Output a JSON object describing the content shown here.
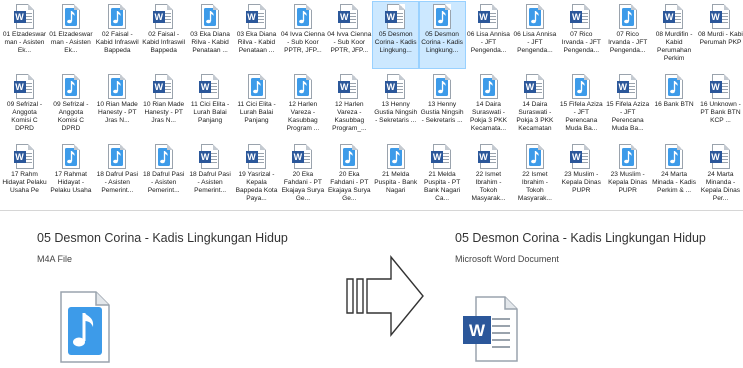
{
  "files": [
    {
      "type": "word",
      "label": "01 Elzadeswar man - Asisten Ek..."
    },
    {
      "type": "music",
      "label": "01 Elzadeswar man - Asisten Ek..."
    },
    {
      "type": "music",
      "label": "02 Faisal - Kabid Infraswil Bappeda"
    },
    {
      "type": "word",
      "label": "02 Faisal - Kabid Infraswil Bappeda"
    },
    {
      "type": "music",
      "label": "03 Eka Diana Rilva - Kabid Penataan ..."
    },
    {
      "type": "word",
      "label": "03 Eka Diana Rilva - Kabid Penataan ..."
    },
    {
      "type": "music",
      "label": "04 Ivva Cienna - Sub Koor PPTR, JFP..."
    },
    {
      "type": "word",
      "label": "04 Ivva Cienna - Sub Koor PPTR, JFP..."
    },
    {
      "type": "word",
      "label": "05 Desmon Corina - Kadis Lingkung...",
      "selected": true
    },
    {
      "type": "music",
      "label": "05 Desmon Corina - Kadis Lingkung...",
      "selected": true
    },
    {
      "type": "word",
      "label": "06 Lisa Annisa - JFT Pengenda..."
    },
    {
      "type": "music",
      "label": "06 Lisa Annisa - JFT Pengenda..."
    },
    {
      "type": "word",
      "label": "07 Rico Irvanda - JFT Pengenda..."
    },
    {
      "type": "music",
      "label": "07 Rico Irvanda - JFT Pengenda..."
    },
    {
      "type": "word",
      "label": "08 Murdifin - Kabid Perumahan Perkim"
    },
    {
      "type": "word",
      "label": "08 Murdi - Kabi Perumah PKP"
    },
    {
      "type": "word",
      "label": "09 Sefrizal - Anggota Komisi C DPRD"
    },
    {
      "type": "music",
      "label": "09 Sefrizal - Anggota Komisi C DPRD"
    },
    {
      "type": "music",
      "label": "10 Rian Made Hanesty - PT Jras N..."
    },
    {
      "type": "word",
      "label": "10 Rian Made Hanesty - PT Jras N..."
    },
    {
      "type": "word",
      "label": "11 Cici Elita - Lurah Balai Panjang"
    },
    {
      "type": "music",
      "label": "11 Cici Elita - Lurah Balai Panjang"
    },
    {
      "type": "music",
      "label": "12 Harlen Vareza - Kasubbag Program ..."
    },
    {
      "type": "word",
      "label": "12 Harlen Vareza - Kasubbag Program_..."
    },
    {
      "type": "word",
      "label": "13 Henny Gustia Ningsih - Sekretaris ..."
    },
    {
      "type": "music",
      "label": "13 Henny Gustia Ningsih - Sekretaris ..."
    },
    {
      "type": "music",
      "label": "14 Daira Suraswati - Pokja 3 PKK Kecamata..."
    },
    {
      "type": "word",
      "label": "14 Daira Suraswati - Pokja 3 PKK Kecamatan"
    },
    {
      "type": "music",
      "label": "15 Fifela Aziza - JFT Perencana Muda Ba..."
    },
    {
      "type": "word",
      "label": "15 Fifela Aziza - JFT Perencana Muda Ba..."
    },
    {
      "type": "music",
      "label": "16 Bank BTN"
    },
    {
      "type": "word",
      "label": "16 Unknown - PT Bank BTN KCP ..."
    },
    {
      "type": "word",
      "label": "17 Rahm Hidayat Pelaku Usaha Pe"
    },
    {
      "type": "music",
      "label": "17 Rahmat Hidayat - Pelaku Usaha"
    },
    {
      "type": "music",
      "label": "18 Dafrul Pasi - Asisten Pemerint..."
    },
    {
      "type": "music",
      "label": "18 Dafrul Pasi - Asisten Pemerint..."
    },
    {
      "type": "word",
      "label": "18 Dafrul Pasi - Asisten Pemerint..."
    },
    {
      "type": "word",
      "label": "19 Yasrizal - Kepala Bappeda Kota Paya..."
    },
    {
      "type": "word",
      "label": "20 Eka Fahdani - PT Ekajaya Surya Ge..."
    },
    {
      "type": "music",
      "label": "20 Eka Fahdani - PT Ekajaya Surya Ge..."
    },
    {
      "type": "music",
      "label": "21 Melda Puspita - Bank Nagari"
    },
    {
      "type": "word",
      "label": "21 Melda Puspita - PT Bank Nagari Ca..."
    },
    {
      "type": "word",
      "label": "22 Ismet Ibrahim - Tokoh Masyarak..."
    },
    {
      "type": "music",
      "label": "22 Ismet Ibrahim - Tokoh Masyarak..."
    },
    {
      "type": "word",
      "label": "23 Muslim - Kepala Dinas PUPR"
    },
    {
      "type": "music",
      "label": "23 Muslim - Kepala Dinas PUPR"
    },
    {
      "type": "music",
      "label": "24 Marta Minada - Kadis Perkim & ..."
    },
    {
      "type": "word",
      "label": "24 Marta Minanda - Kepala Dinas Per..."
    }
  ],
  "conversion": {
    "source": {
      "title": "05 Desmon Corina - Kadis Lingkungan Hidup",
      "subtitle": "M4A File"
    },
    "target": {
      "title": "05 Desmon Corina - Kadis Lingkungan Hidup",
      "subtitle": "Microsoft Word Document"
    }
  },
  "colors": {
    "word": "#2b579a",
    "music": "#2f8ed8",
    "selection": "#cce8ff"
  }
}
